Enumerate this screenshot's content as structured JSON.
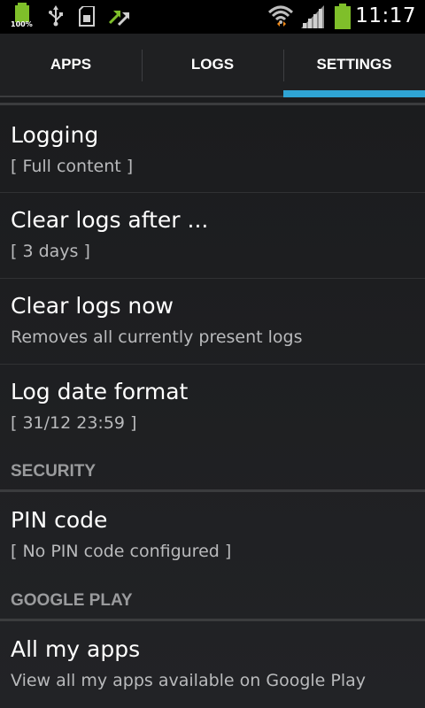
{
  "status_bar": {
    "battery_percent_label": "100%",
    "time": "11:17",
    "icons": [
      "battery-icon",
      "usb-icon",
      "sd-card-icon",
      "sync-icon",
      "wifi-icon",
      "signal-icon",
      "battery-status-icon"
    ]
  },
  "tabs": [
    {
      "label": "APPS",
      "selected": false
    },
    {
      "label": "LOGS",
      "selected": false
    },
    {
      "label": "SETTINGS",
      "selected": true
    }
  ],
  "accent_color": "#2fa4d4",
  "preferences": [
    {
      "title": "Logging",
      "summary": "[ Full content ]"
    },
    {
      "title": "Clear logs after ...",
      "summary": "[ 3 days ]"
    },
    {
      "title": "Clear logs now",
      "summary": "Removes all currently present logs"
    },
    {
      "title": "Log date format",
      "summary": "[ 31/12 23:59 ]"
    }
  ],
  "security": {
    "header": "SECURITY",
    "items": [
      {
        "title": "PIN code",
        "summary": "[ No PIN code configured ]"
      }
    ]
  },
  "google_play": {
    "header": "GOOGLE PLAY",
    "items": [
      {
        "title": "All my apps",
        "summary": "View all my apps available on Google Play"
      }
    ]
  }
}
